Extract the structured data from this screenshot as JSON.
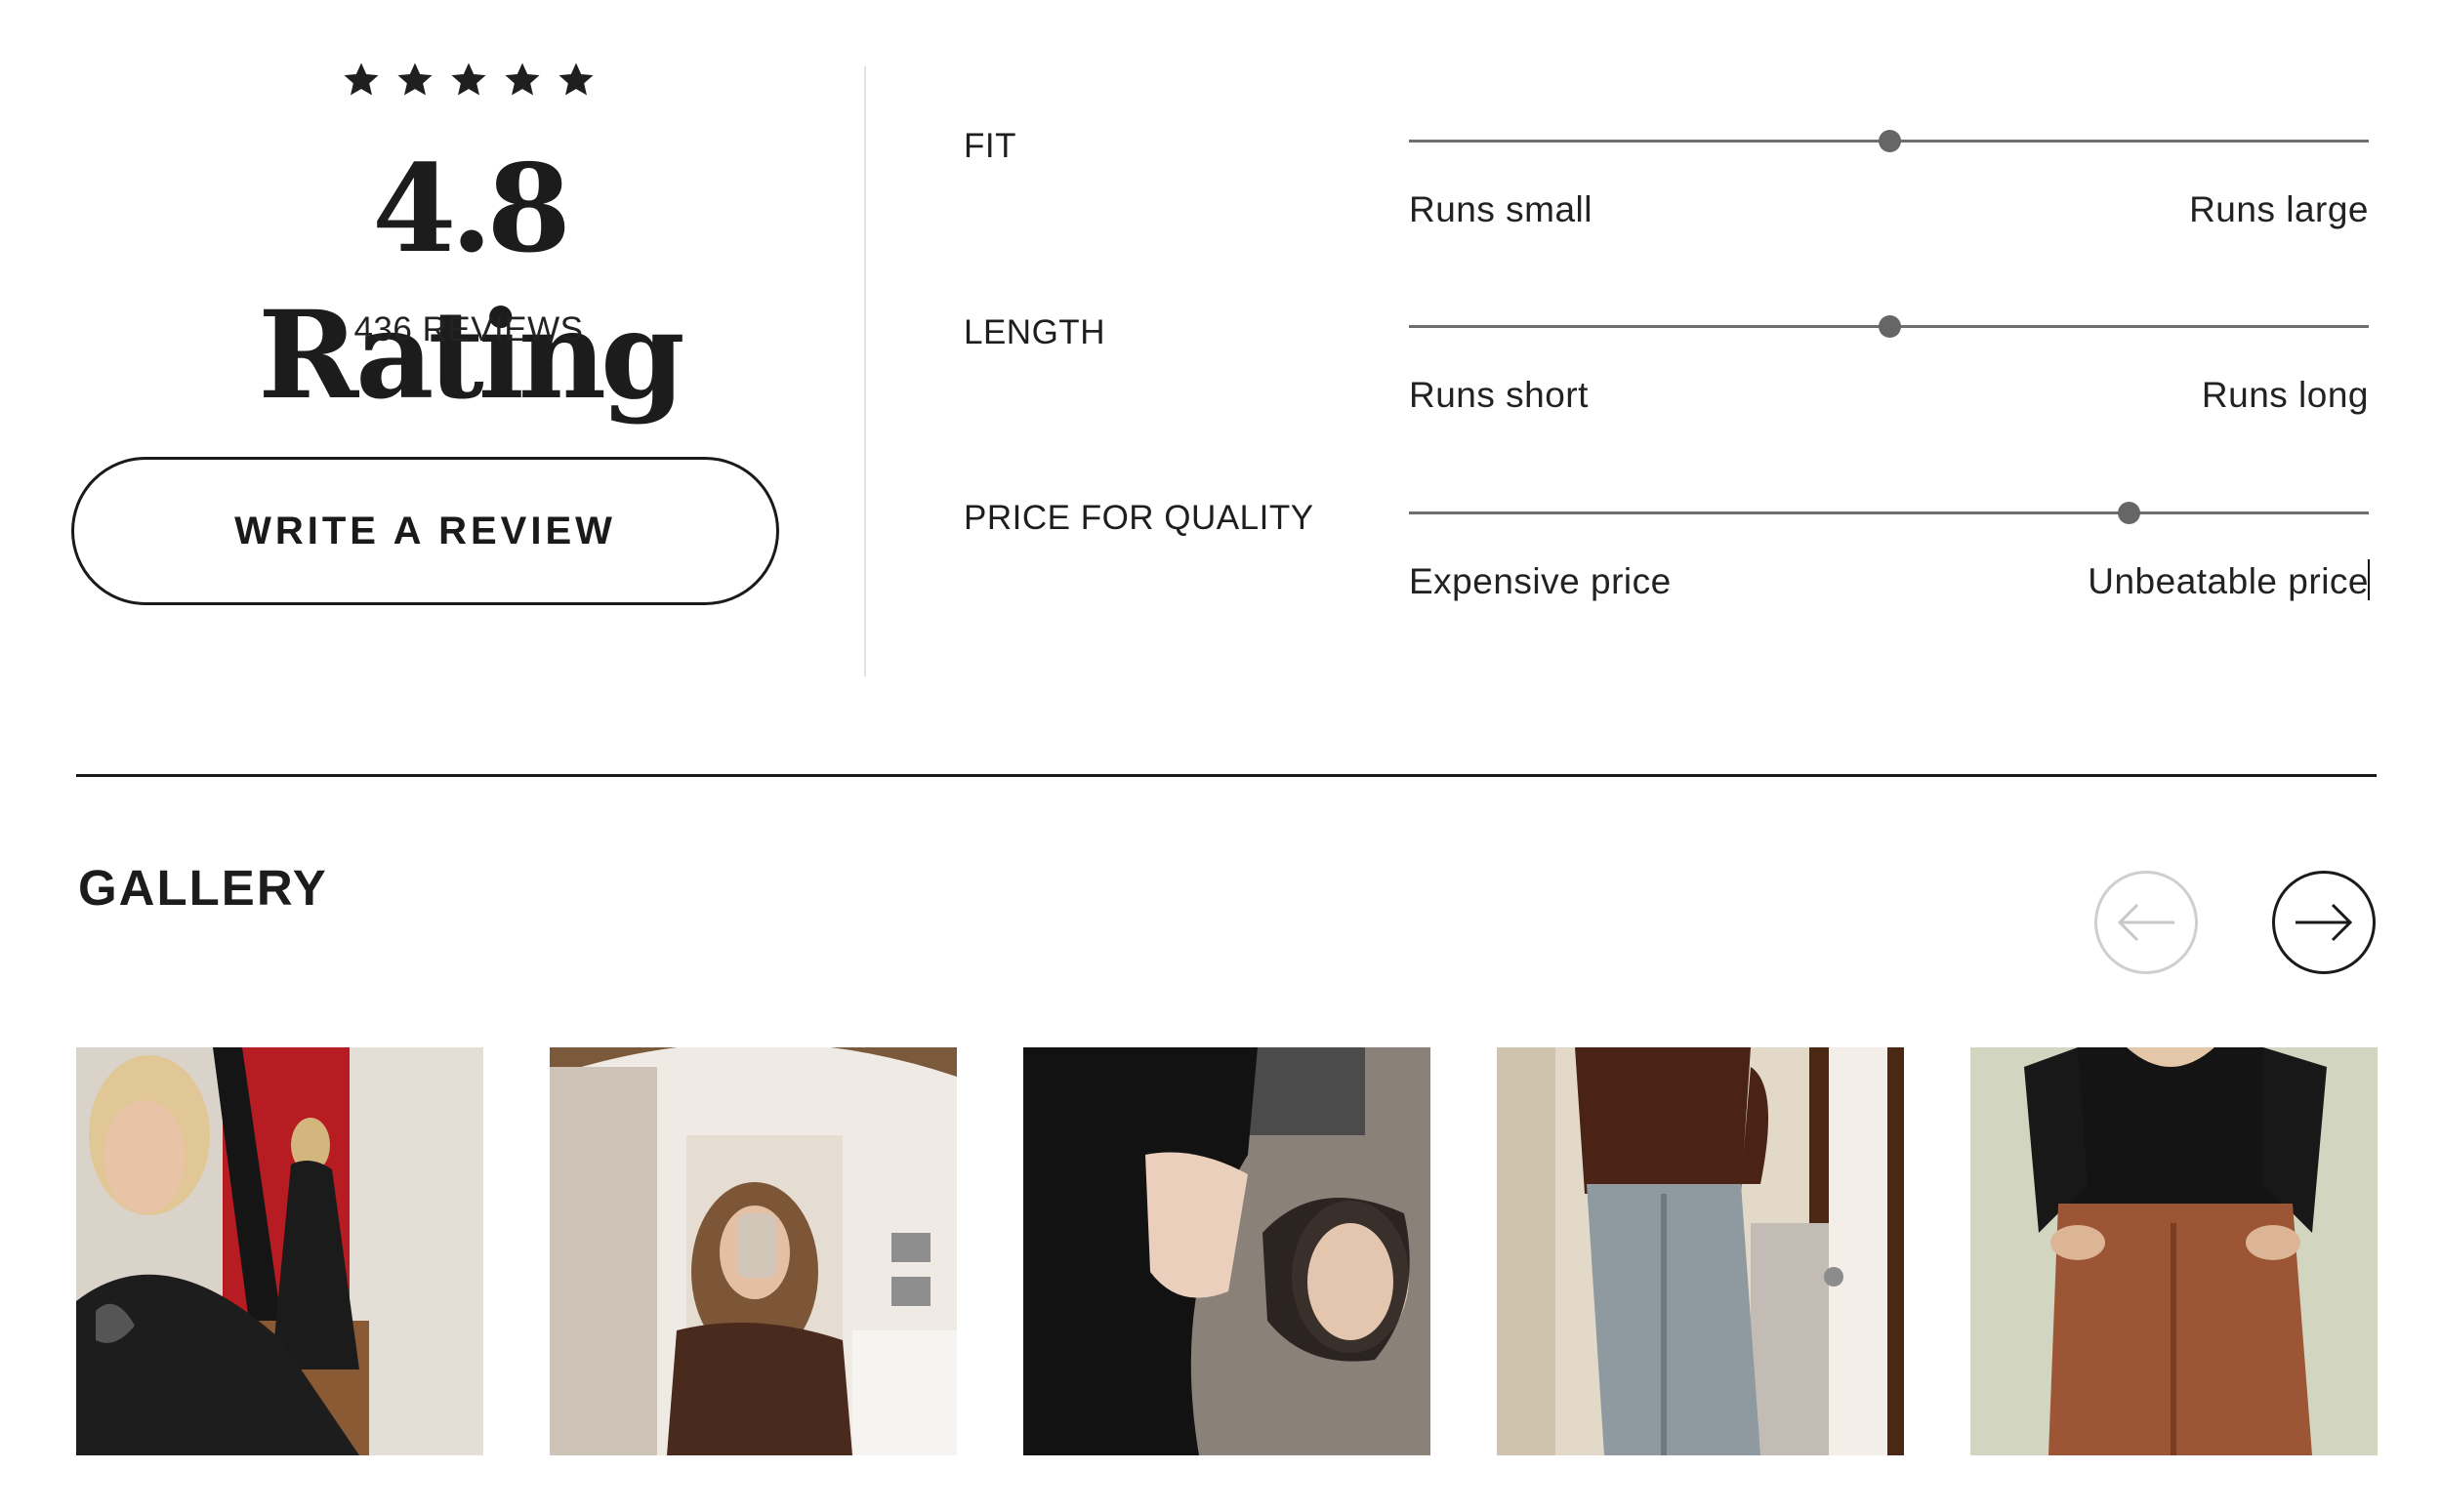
{
  "rating": {
    "stars_filled": 5,
    "stars_total": 5,
    "star_icon": "star-icon",
    "heading": "4.8 Rating",
    "review_count": "436 REVIEWS",
    "write_review_label": "WRITE A REVIEW"
  },
  "attributes": [
    {
      "label": "FIT",
      "left_label": "Runs small",
      "right_label": "Runs large",
      "value": 0.5
    },
    {
      "label": "LENGTH",
      "left_label": "Runs short",
      "right_label": "Runs long",
      "value": 0.5
    },
    {
      "label": "PRICE FOR QUALITY",
      "left_label": "Expensive price",
      "right_label": "Unbeatable price",
      "value": 0.75
    }
  ],
  "gallery": {
    "title": "GALLERY",
    "prev_icon": "arrow-left-icon",
    "next_icon": "arrow-right-icon",
    "prev_enabled": false,
    "next_enabled": true,
    "photo_count": 5
  },
  "colors": {
    "text": "#1a1a1a",
    "slider_track": "#6e6e6e",
    "slider_knob": "#666666",
    "disabled_border": "#cfcfcf",
    "divider": "#e2e2e2"
  }
}
